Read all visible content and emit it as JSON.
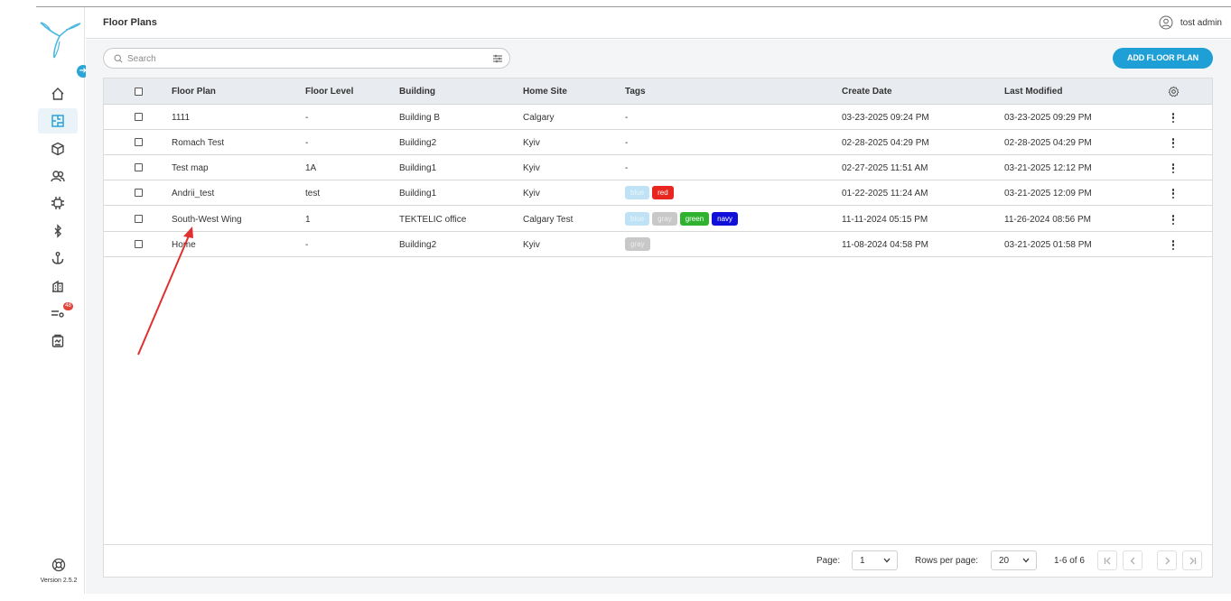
{
  "app": {
    "version": "Version 2.5.2",
    "page_title": "Floor Plans",
    "user_name": "tost admin",
    "accent": "#1e9fd6"
  },
  "sidebar": {
    "items": [
      {
        "name": "home-icon",
        "active": false
      },
      {
        "name": "floor-plan-icon",
        "active": true
      },
      {
        "name": "cube-icon",
        "active": false
      },
      {
        "name": "users-icon",
        "active": false
      },
      {
        "name": "chip-icon",
        "active": false
      },
      {
        "name": "bluetooth-icon",
        "active": false
      },
      {
        "name": "anchor-icon",
        "active": false
      },
      {
        "name": "building-icon",
        "active": false
      },
      {
        "name": "alerts-icon",
        "active": false,
        "badge": "48"
      },
      {
        "name": "reports-icon",
        "active": false
      }
    ]
  },
  "toolbar": {
    "search_placeholder": "Search",
    "add_label": "ADD FLOOR PLAN"
  },
  "table": {
    "columns": [
      "Floor Plan",
      "Floor Level",
      "Building",
      "Home Site",
      "Tags",
      "Create Date",
      "Last Modified"
    ],
    "rows": [
      {
        "plan": "1111",
        "level": "-",
        "building": "Building B",
        "site": "Calgary",
        "tags_text": "-",
        "tags": [],
        "created": "03-23-2025 09:24 PM",
        "modified": "03-23-2025 09:29 PM"
      },
      {
        "plan": "Romach Test",
        "level": "-",
        "building": "Building2",
        "site": "Kyiv",
        "tags_text": "-",
        "tags": [],
        "created": "02-28-2025 04:29 PM",
        "modified": "02-28-2025 04:29 PM"
      },
      {
        "plan": "Test map",
        "level": "1A",
        "building": "Building1",
        "site": "Kyiv",
        "tags_text": "-",
        "tags": [],
        "created": "02-27-2025 11:51 AM",
        "modified": "03-21-2025 12:12 PM"
      },
      {
        "plan": "Andrii_test",
        "level": "test",
        "building": "Building1",
        "site": "Kyiv",
        "tags_text": "",
        "tags": [
          {
            "label": "blue",
            "bg": "#bfe3f5",
            "fg": "#eaf6fc"
          },
          {
            "label": "red",
            "bg": "#e8251f",
            "fg": "#ffffff"
          }
        ],
        "created": "01-22-2025 11:24 AM",
        "modified": "03-21-2025 12:09 PM"
      },
      {
        "plan": "South-West Wing",
        "level": "1",
        "building": "TEKTELIC office",
        "site": "Calgary Test",
        "tags_text": "",
        "tags": [
          {
            "label": "blue",
            "bg": "#bfe3f5",
            "fg": "#eaf6fc"
          },
          {
            "label": "gray",
            "bg": "#c8c8c8",
            "fg": "#eeeeee"
          },
          {
            "label": "green",
            "bg": "#2fb32f",
            "fg": "#ffffff"
          },
          {
            "label": "navy",
            "bg": "#1010d8",
            "fg": "#ffffff"
          }
        ],
        "created": "11-11-2024 05:15 PM",
        "modified": "11-26-2024 08:56 PM"
      },
      {
        "plan": "Home",
        "level": "-",
        "building": "Building2",
        "site": "Kyiv",
        "tags_text": "",
        "tags": [
          {
            "label": "gray",
            "bg": "#c8c8c8",
            "fg": "#eeeeee"
          }
        ],
        "created": "11-08-2024 04:58 PM",
        "modified": "03-21-2025 01:58 PM"
      }
    ]
  },
  "pagination": {
    "page_label": "Page:",
    "page_value": "1",
    "rows_label": "Rows per page:",
    "rows_value": "20",
    "range_text": "1-6 of 6"
  },
  "annotation": {
    "arrow_color": "#e03030"
  }
}
